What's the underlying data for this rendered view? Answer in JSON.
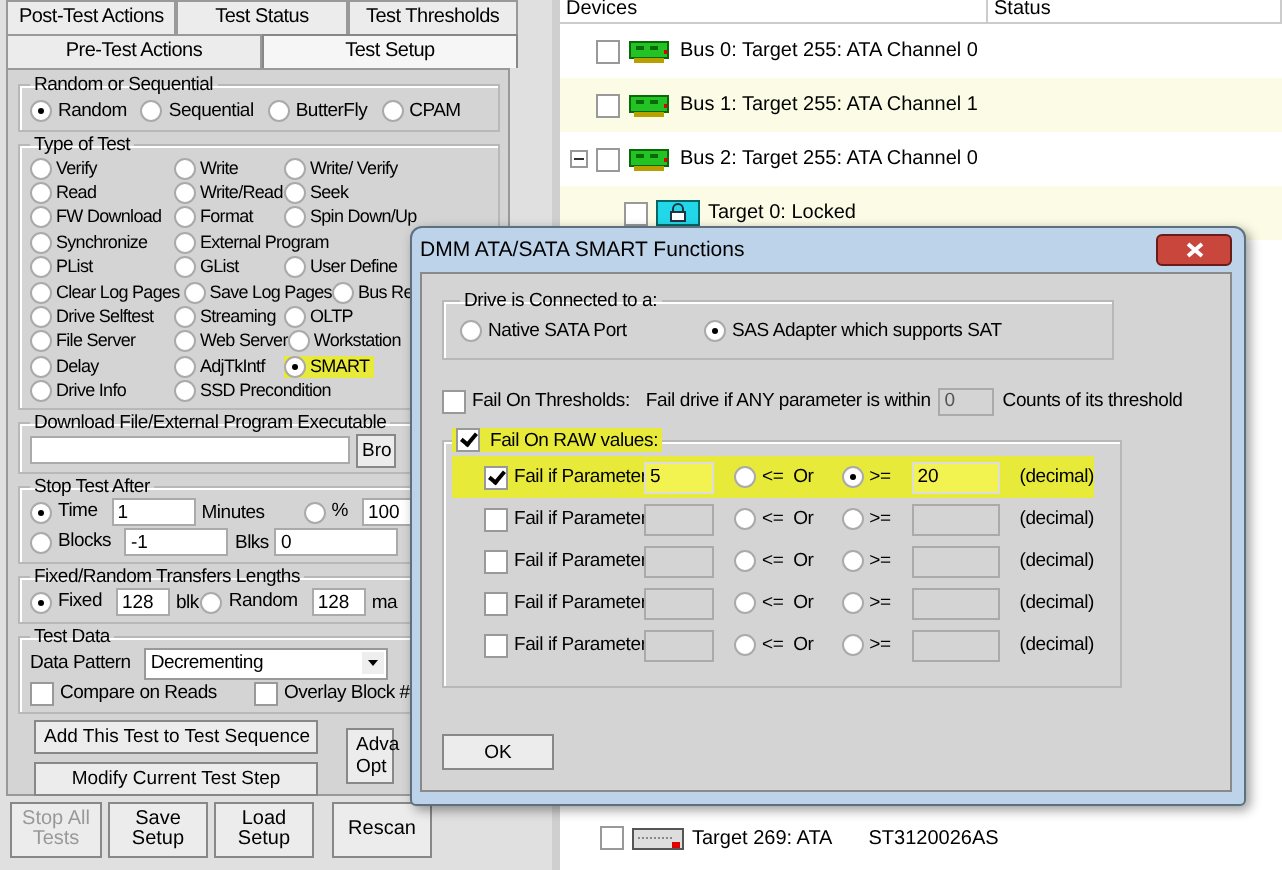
{
  "tabs_row1": [
    {
      "label": "Post-Test Actions",
      "selected": false
    },
    {
      "label": "Test Status",
      "selected": false
    },
    {
      "label": "Test Thresholds",
      "selected": false
    }
  ],
  "tabs_row2": [
    {
      "label": "Pre-Test Actions",
      "selected": false
    },
    {
      "label": "Test Setup",
      "selected": true
    }
  ],
  "random_or_sequential": {
    "title": "Random or Sequential",
    "options": [
      {
        "label": "Random",
        "selected": true
      },
      {
        "label": "Sequential",
        "selected": false
      },
      {
        "label": "ButterFly",
        "selected": false
      },
      {
        "label": "CPAM",
        "selected": false
      }
    ]
  },
  "type_of_test": {
    "title": "Type of Test",
    "rows": [
      [
        {
          "label": "Verify",
          "selected": false,
          "highlighted": false
        },
        {
          "label": "Write",
          "selected": false,
          "highlighted": false
        },
        {
          "label": "Write/ Verify",
          "selected": false,
          "highlighted": false
        }
      ],
      [
        {
          "label": "Read",
          "selected": false,
          "highlighted": false
        },
        {
          "label": "Write/Read",
          "selected": false,
          "highlighted": false
        },
        {
          "label": "Seek",
          "selected": false,
          "highlighted": false
        }
      ],
      [
        {
          "label": "FW Download",
          "selected": false,
          "highlighted": false
        },
        {
          "label": "Format",
          "selected": false,
          "highlighted": false
        },
        {
          "label": "Spin Down/Up",
          "selected": false,
          "highlighted": false
        }
      ],
      [
        {
          "label": "Synchronize",
          "selected": false,
          "highlighted": false
        },
        {
          "label": "External Program",
          "selected": false,
          "highlighted": false
        }
      ],
      [
        {
          "label": "PList",
          "selected": false,
          "highlighted": false
        },
        {
          "label": "GList",
          "selected": false,
          "highlighted": false
        },
        {
          "label": "User Define",
          "selected": false,
          "highlighted": false
        }
      ],
      [
        {
          "label": "Clear Log Pages",
          "selected": false,
          "highlighted": false
        },
        {
          "label": "Save Log Pages",
          "selected": false,
          "highlighted": false
        },
        {
          "label": "Bus Re",
          "selected": false,
          "highlighted": false
        }
      ],
      [
        {
          "label": "Drive Selftest",
          "selected": false,
          "highlighted": false
        },
        {
          "label": "Streaming",
          "selected": false,
          "highlighted": false
        },
        {
          "label": "OLTP",
          "selected": false,
          "highlighted": false
        }
      ],
      [
        {
          "label": "File Server",
          "selected": false,
          "highlighted": false
        },
        {
          "label": "Web Server",
          "selected": false,
          "highlighted": false
        },
        {
          "label": "Workstation",
          "selected": false,
          "highlighted": false
        }
      ],
      [
        {
          "label": "Delay",
          "selected": false,
          "highlighted": false
        },
        {
          "label": "AdjTkIntf",
          "selected": false,
          "highlighted": false
        },
        {
          "label": "SMART",
          "selected": true,
          "highlighted": true
        }
      ],
      [
        {
          "label": "Drive Info",
          "selected": false,
          "highlighted": false
        },
        {
          "label": "SSD Precondition",
          "selected": false,
          "highlighted": false
        }
      ]
    ]
  },
  "download": {
    "title": "Download File/External Program Executable",
    "button": "Bro"
  },
  "stop_test_after": {
    "title": "Stop Test After",
    "time": {
      "label": "Time",
      "selected": true,
      "value": "1",
      "unit": "Minutes"
    },
    "percent": {
      "label": "%",
      "selected": false,
      "value": "100"
    },
    "blocks": {
      "label": "Blocks",
      "selected": false,
      "value": "-1",
      "unit": "Blks",
      "value2": "0"
    }
  },
  "transfer_lengths": {
    "title": "Fixed/Random Transfers Lengths",
    "fixed": {
      "label": "Fixed",
      "selected": true,
      "value": "128",
      "unit": "blk"
    },
    "random": {
      "label": "Random",
      "selected": false,
      "value": "128",
      "unit": "ma"
    }
  },
  "test_data": {
    "title": "Test Data",
    "pattern_label": "Data Pattern",
    "pattern": "Decrementing",
    "checkboxes": [
      {
        "label": "Compare on Reads",
        "checked": false
      },
      {
        "label": "Overlay Block #",
        "checked": false
      }
    ]
  },
  "add_button": "Add This Test to Test Sequence",
  "modify_button": "Modify Current Test Step",
  "advanced_button": [
    "Adva",
    "Opt"
  ],
  "bottom_buttons": [
    {
      "label": "Stop All Tests",
      "disabled": true
    },
    {
      "label": "Save Setup",
      "disabled": false
    },
    {
      "label": "Load Setup",
      "disabled": false
    },
    {
      "label": "Rescan",
      "disabled": false
    }
  ],
  "devices": {
    "columns": [
      "Devices",
      "Status"
    ],
    "nodes": [
      {
        "label": "Bus 0: Target 255: ATA Channel 0",
        "kind": "bus",
        "checked": false
      },
      {
        "label": "Bus 1: Target 255: ATA Channel 1",
        "kind": "bus",
        "checked": false
      },
      {
        "label": "Bus 2: Target 255: ATA Channel 0",
        "kind": "bus",
        "checked": false,
        "expanded": true,
        "children": [
          {
            "label": "Target 0: Locked",
            "kind": "locked",
            "checked": false
          }
        ]
      }
    ],
    "tail": {
      "label": "Target 269: ATA",
      "model": "ST3120026AS",
      "kind": "drive",
      "checked": false
    }
  },
  "dialog": {
    "title": "DMM ATA/SATA SMART Functions",
    "connection": {
      "title": "Drive is Connected to a:",
      "options": [
        {
          "label": "Native SATA Port",
          "selected": false
        },
        {
          "label": "SAS Adapter which supports SAT",
          "selected": true
        }
      ]
    },
    "thresholds": {
      "label": "Fail On Thresholds:",
      "checked": false,
      "text": "Fail drive if ANY parameter is within",
      "value": "0",
      "suffix": "Counts of its threshold"
    },
    "raw": {
      "label": "Fail On RAW values:",
      "checked": true,
      "highlighted": true,
      "rows": [
        {
          "label": "Fail if Parameter",
          "checked": true,
          "highlighted": true,
          "value": "5",
          "le": "<=",
          "or": "Or",
          "ge": ">=",
          "le_selected": false,
          "ge_selected": true,
          "limit": "20",
          "unit": "(decimal)"
        },
        {
          "label": "Fail if Parameter",
          "checked": false,
          "highlighted": false,
          "le": "<=",
          "or": "Or",
          "ge": ">=",
          "le_selected": false,
          "ge_selected": false,
          "unit": "(decimal)"
        },
        {
          "label": "Fail if Parameter",
          "checked": false,
          "highlighted": false,
          "le": "<=",
          "or": "Or",
          "ge": ">=",
          "le_selected": false,
          "ge_selected": false,
          "unit": "(decimal)"
        },
        {
          "label": "Fail if Parameter",
          "checked": false,
          "highlighted": false,
          "le": "<=",
          "or": "Or",
          "ge": ">=",
          "le_selected": false,
          "ge_selected": false,
          "unit": "(decimal)"
        },
        {
          "label": "Fail if Parameter",
          "checked": false,
          "highlighted": false,
          "le": "<=",
          "or": "Or",
          "ge": ">=",
          "le_selected": false,
          "ge_selected": false,
          "unit": "(decimal)"
        }
      ]
    },
    "ok_button": "OK"
  }
}
